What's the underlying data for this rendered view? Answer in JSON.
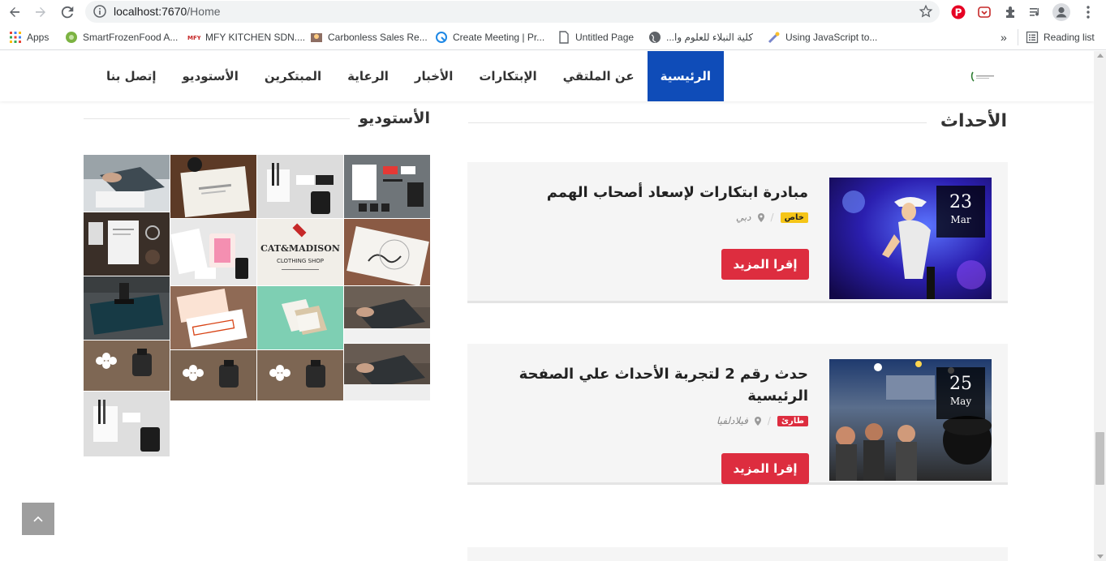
{
  "browser": {
    "url_host": "localhost:7670",
    "url_path": "/Home",
    "bookmarks": [
      {
        "label": "Apps",
        "icon": "apps-grid-icon"
      },
      {
        "label": "SmartFrozenFood A...",
        "icon": "smartfrozenfood-favicon"
      },
      {
        "label": "MFY KITCHEN SDN....",
        "icon": "mfy-favicon"
      },
      {
        "label": "Carbonless Sales Re...",
        "icon": "carbonless-favicon"
      },
      {
        "label": "Create Meeting | Pr...",
        "icon": "meeting-favicon"
      },
      {
        "label": "Untitled Page",
        "icon": "page-icon"
      },
      {
        "label": "كلية النبلاء للعلوم وا...",
        "icon": "globe-icon"
      },
      {
        "label": "Using JavaScript to...",
        "icon": "javascript-favicon"
      }
    ],
    "more_label": "»",
    "reading_list_label": "Reading list"
  },
  "nav": {
    "items": [
      {
        "label": "الرئيسية",
        "active": true
      },
      {
        "label": "عن الملتقي",
        "active": false
      },
      {
        "label": "الإبتكارات",
        "active": false
      },
      {
        "label": "الأخبار",
        "active": false
      },
      {
        "label": "الرعاية",
        "active": false
      },
      {
        "label": "المبتكرين",
        "active": false
      },
      {
        "label": "الأستوديو",
        "active": false
      },
      {
        "label": "إتصل بنا",
        "active": false
      }
    ]
  },
  "events": {
    "heading": "الأحداث",
    "items": [
      {
        "title": "مبادرة ابتكارات لإسعاد أصحاب الهمم",
        "day": "23",
        "month": "Mar",
        "badge": "خاص",
        "badge_color": "#f5c518",
        "location": "دبي",
        "button": "إقرا المزيد"
      },
      {
        "title": "حدث رقم 2 لتجربة الأحداث علي الصفحة الرئيسية",
        "day": "25",
        "month": "May",
        "badge": "طارئ",
        "badge_color": "#dd2d3f",
        "location": "فيلادلفيا",
        "button": "إقرا المزيد"
      }
    ]
  },
  "studio": {
    "heading": "الأستوديو"
  },
  "colors": {
    "nav_active": "#0f4cb8",
    "button": "#dd2d3f"
  }
}
